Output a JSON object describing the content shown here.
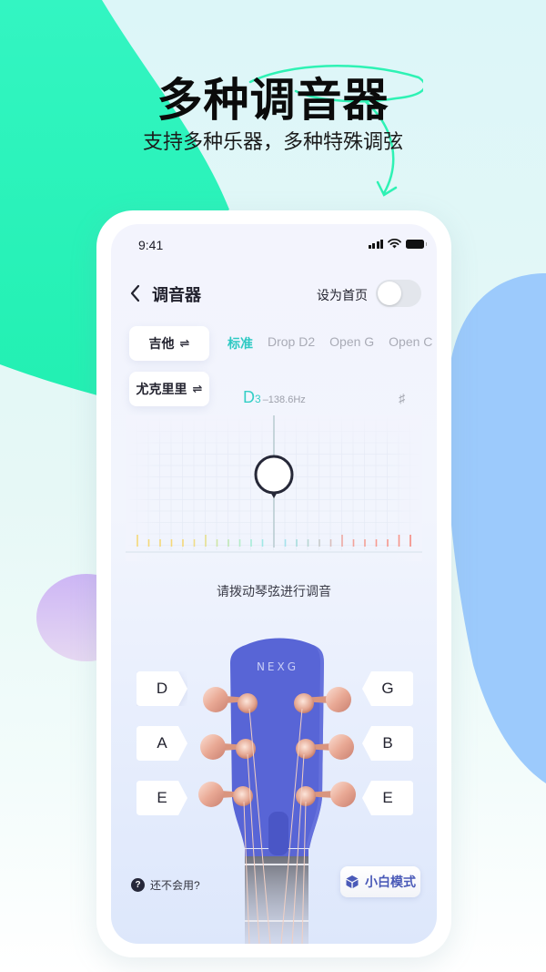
{
  "promo": {
    "headline": "多种调音器",
    "subheadline": "支持多种乐器，多种特殊调弦"
  },
  "colors": {
    "accent_teal": "#2ec9c3",
    "promo_green": "#2ff5c0",
    "guitar_blue": "#5865d6",
    "easy_mode_text": "#4a5ab8"
  },
  "status_bar": {
    "time": "9:41",
    "icons": [
      "signal-icon",
      "wifi-icon",
      "battery-icon"
    ]
  },
  "nav": {
    "back_icon": "chevron-left-icon",
    "title": "调音器",
    "set_home_label": "设为首页",
    "set_home_enabled": false
  },
  "instruments": [
    {
      "label": "吉他",
      "icon": "swap-icon",
      "swap_glyph": "⇌"
    },
    {
      "label": "尤克里里",
      "icon": "swap-icon",
      "swap_glyph": "⇌"
    }
  ],
  "tunings": [
    {
      "label": "标准",
      "active": true
    },
    {
      "label": "Drop D2",
      "active": false
    },
    {
      "label": "Open G",
      "active": false
    },
    {
      "label": "Open C",
      "active": false
    }
  ],
  "reading": {
    "note": "D",
    "octave": "3",
    "frequency": "–138.6Hz",
    "sharp_symbol": "♯"
  },
  "prompt": "请拨动琴弦进行调音",
  "guitar": {
    "brand": "NEXG",
    "left_strings": [
      "D",
      "A",
      "E"
    ],
    "right_strings": [
      "G",
      "B",
      "E"
    ]
  },
  "footer": {
    "help_icon_glyph": "?",
    "help_text": "还不会用?",
    "easy_mode_label": "小白模式",
    "easy_mode_icon": "cube-icon"
  }
}
